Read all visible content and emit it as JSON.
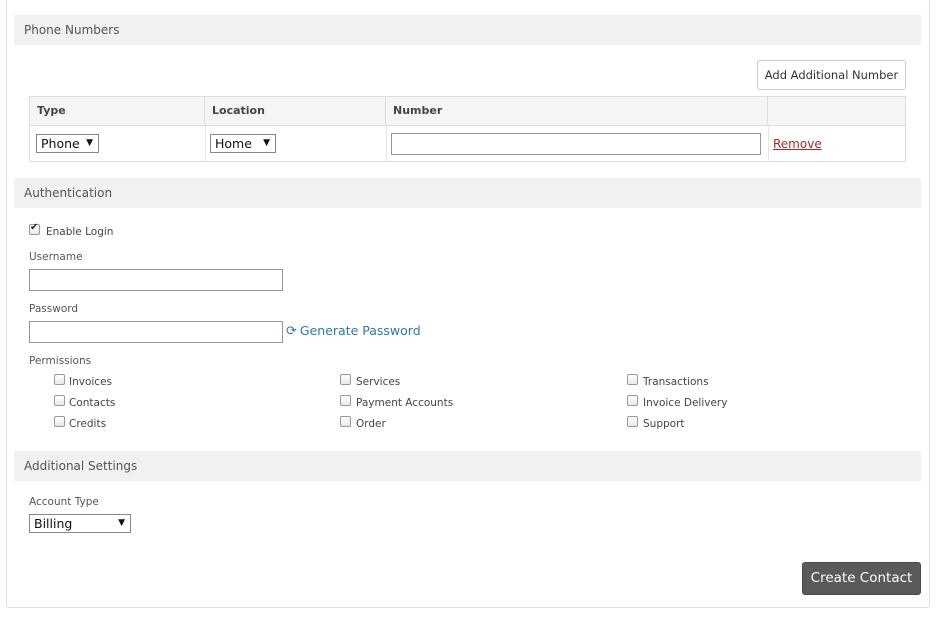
{
  "phone_numbers": {
    "header": "Phone Numbers",
    "add_button": "Add Additional Number",
    "columns": [
      "Type",
      "Location",
      "Number",
      ""
    ],
    "row": {
      "type_value": "Phone",
      "location_value": "Home",
      "number_value": "",
      "remove_label": "Remove"
    }
  },
  "authentication": {
    "header": "Authentication",
    "enable_login_label": "Enable Login",
    "enable_login_checked": true,
    "username_label": "Username",
    "username_value": "",
    "password_label": "Password",
    "password_value": "",
    "generate_password_label": "Generate Password",
    "permissions_label": "Permissions",
    "permissions": [
      {
        "label": "Invoices",
        "checked": false
      },
      {
        "label": "Services",
        "checked": false
      },
      {
        "label": "Transactions",
        "checked": false
      },
      {
        "label": "Contacts",
        "checked": false
      },
      {
        "label": "Payment Accounts",
        "checked": false
      },
      {
        "label": "Invoice Delivery",
        "checked": false
      },
      {
        "label": "Credits",
        "checked": false
      },
      {
        "label": "Order",
        "checked": false
      },
      {
        "label": "Support",
        "checked": false
      }
    ]
  },
  "additional_settings": {
    "header": "Additional Settings",
    "account_type_label": "Account Type",
    "account_type_value": "Billing"
  },
  "submit_label": "Create Contact",
  "colors": {
    "section_bg": "#f1f1f1",
    "link_blue": "#2a7ab0",
    "remove_red": "#a52b2b",
    "primary_button": "#5a5a5a"
  },
  "icons": {
    "dropdown": "triangle-down-icon",
    "generate": "refresh-icon",
    "checkbox": "checkbox-icon"
  }
}
